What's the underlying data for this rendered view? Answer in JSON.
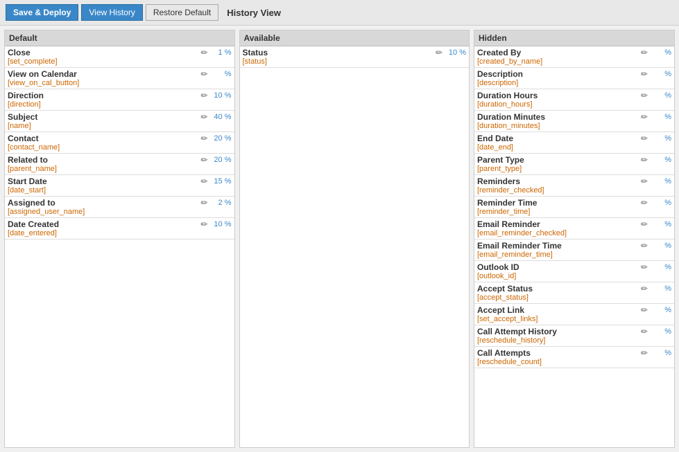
{
  "topbar": {
    "save_deploy_label": "Save & Deploy",
    "view_history_label": "View History",
    "restore_default_label": "Restore Default",
    "history_view_label": "History View"
  },
  "panels": {
    "default": {
      "header": "Default",
      "fields": [
        {
          "label": "Close",
          "key": "[set_complete]",
          "pct": "1 %"
        },
        {
          "label": "View on Calendar",
          "key": "[view_on_cal_button]",
          "pct": "%"
        },
        {
          "label": "Direction",
          "key": "[direction]",
          "pct": "10 %"
        },
        {
          "label": "Subject",
          "key": "[name]",
          "pct": "40 %"
        },
        {
          "label": "Contact",
          "key": "[contact_name]",
          "pct": "20 %"
        },
        {
          "label": "Related to",
          "key": "[parent_name]",
          "pct": "20 %"
        },
        {
          "label": "Start Date",
          "key": "[date_start]",
          "pct": "15 %"
        },
        {
          "label": "Assigned to",
          "key": "[assigned_user_name]",
          "pct": "2 %"
        },
        {
          "label": "Date Created",
          "key": "[date_entered]",
          "pct": "10 %"
        }
      ]
    },
    "available": {
      "header": "Available",
      "fields": [
        {
          "label": "Status",
          "key": "[status]",
          "pct": "10 %"
        }
      ]
    },
    "hidden": {
      "header": "Hidden",
      "fields": [
        {
          "label": "Created By",
          "key": "[created_by_name]",
          "pct": "%"
        },
        {
          "label": "Description",
          "key": "[description]",
          "pct": "%"
        },
        {
          "label": "Duration Hours",
          "key": "[duration_hours]",
          "pct": "%"
        },
        {
          "label": "Duration Minutes",
          "key": "[duration_minutes]",
          "pct": "%"
        },
        {
          "label": "End Date",
          "key": "[date_end]",
          "pct": "%"
        },
        {
          "label": "Parent Type",
          "key": "[parent_type]",
          "pct": "%"
        },
        {
          "label": "Reminders",
          "key": "[reminder_checked]",
          "pct": "%"
        },
        {
          "label": "Reminder Time",
          "key": "[reminder_time]",
          "pct": "%"
        },
        {
          "label": "Email Reminder",
          "key": "[email_reminder_checked]",
          "pct": "%"
        },
        {
          "label": "Email Reminder Time",
          "key": "[email_reminder_time]",
          "pct": "%"
        },
        {
          "label": "Outlook ID",
          "key": "[outlook_id]",
          "pct": "%"
        },
        {
          "label": "Accept Status",
          "key": "[accept_status]",
          "pct": "%"
        },
        {
          "label": "Accept Link",
          "key": "[set_accept_links]",
          "pct": "%"
        },
        {
          "label": "Call Attempt History",
          "key": "[reschedule_history]",
          "pct": "%"
        },
        {
          "label": "Call Attempts",
          "key": "[reschedule_count]",
          "pct": "%"
        }
      ]
    }
  },
  "icons": {
    "edit": "✏"
  }
}
